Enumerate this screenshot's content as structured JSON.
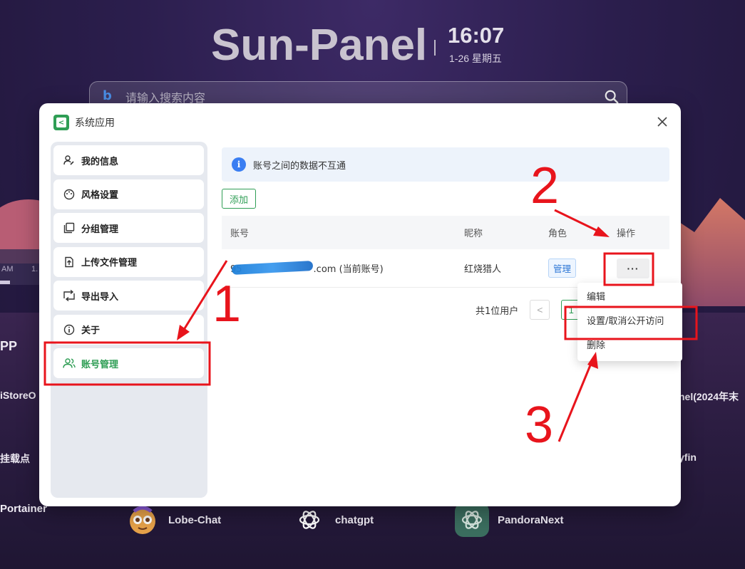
{
  "background": {
    "title": "Sun-Panel",
    "clock_time": "16:07",
    "clock_date": "1-26 星期五",
    "search_placeholder": "请输入搜索内容",
    "left_strip_a": "AM",
    "left_strip_b": "1.",
    "side_labels": {
      "pp": "PP",
      "istore": "iStoreO",
      "mount": "挂载点",
      "panel": "nel(2024年末",
      "fin": "yfin"
    },
    "apps": [
      {
        "name": "Portainer",
        "icon": "portainer-icon"
      },
      {
        "name": "Lobe-Chat",
        "icon": "lobe-chat-icon"
      },
      {
        "name": "chatgpt",
        "icon": "openai-icon"
      },
      {
        "name": "PandoraNext",
        "icon": "openai-icon"
      }
    ]
  },
  "modal": {
    "title": "系统应用",
    "menu": [
      {
        "label": "我的信息",
        "icon": "user-edit-icon"
      },
      {
        "label": "风格设置",
        "icon": "palette-icon"
      },
      {
        "label": "分组管理",
        "icon": "group-icon"
      },
      {
        "label": "上传文件管理",
        "icon": "upload-file-icon"
      },
      {
        "label": "导出导入",
        "icon": "export-import-icon"
      },
      {
        "label": "关于",
        "icon": "info-icon"
      },
      {
        "label": "账号管理",
        "icon": "users-icon",
        "active": true
      }
    ],
    "alert_text": "账号之间的数据不互通",
    "add_button": "添加",
    "table": {
      "headers": [
        "账号",
        "昵称",
        "角色",
        "操作"
      ],
      "rows": [
        {
          "account_prefix": "95",
          "account_suffix": ".com (当前账号)",
          "nickname": "红烧猎人",
          "role": "管理",
          "action": "···"
        }
      ]
    },
    "pager": {
      "total_text": "共1位用户",
      "prev": "<",
      "page": "1"
    },
    "dropdown": [
      "编辑",
      "设置/取消公开访问",
      "删除"
    ]
  },
  "annotations": {
    "num1": "1",
    "num2": "2",
    "num3": "3",
    "color": "#e8141c"
  },
  "colors": {
    "accent": "#2f9e55",
    "info": "#3a7ef2",
    "tag": "#2f78d6"
  }
}
